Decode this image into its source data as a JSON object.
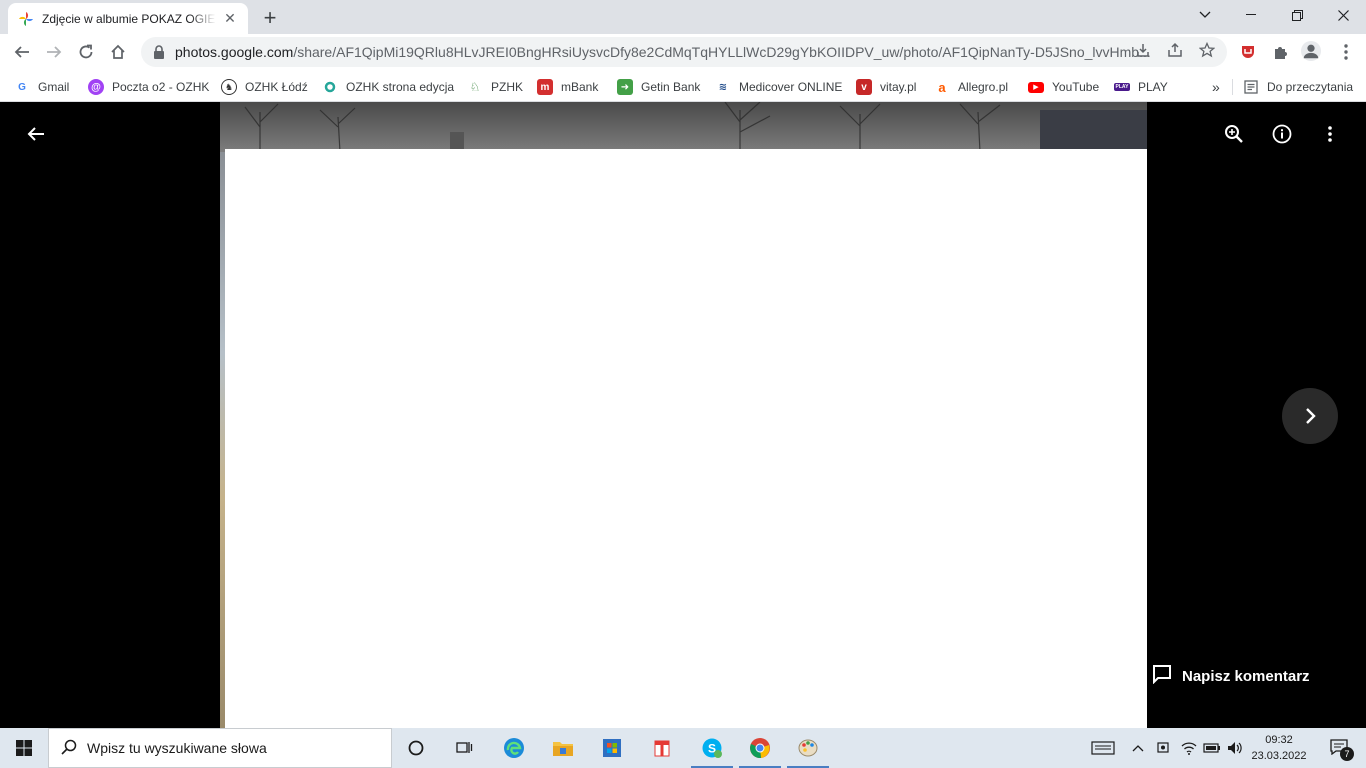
{
  "browser": {
    "tab_title": "Zdjęcie w albumie POKAZ OGIERÓW",
    "url_host": "photos.google.com",
    "url_path": "/share/AF1QipMi19QRlu8HLvJREI0BngHRsiUysvcDfy8e2CdMqTqHYLLlWcD29gYbKOIIDPV_uw/photo/AF1QipNanTy-D5JSno_lvvHmb..."
  },
  "bookmarks": [
    {
      "label": "Gmail",
      "icon": "google-icon",
      "color": "#4285f4"
    },
    {
      "label": "Poczta o2 - OZHK",
      "icon": "o2-mail-icon",
      "color": "#a142f4"
    },
    {
      "label": "OZHK Łódź",
      "icon": "horse-icon",
      "color": "#333333"
    },
    {
      "label": "OZHK strona edycja",
      "icon": "ring-icon",
      "color": "#26a69a"
    },
    {
      "label": "PZHK",
      "icon": "pzhk-icon",
      "color": "#2e7d32"
    },
    {
      "label": "mBank",
      "icon": "mbank-icon",
      "color": "#d32f2f"
    },
    {
      "label": "Getin Bank",
      "icon": "arrow-icon",
      "color": "#43a047"
    },
    {
      "label": "Medicover ONLINE",
      "icon": "medicover-icon",
      "color": "#1e4a8a"
    },
    {
      "label": "vitay.pl",
      "icon": "vitay-icon",
      "color": "#c62828"
    },
    {
      "label": "Allegro.pl",
      "icon": "allegro-icon",
      "color": "#ff5a00"
    },
    {
      "label": "YouTube",
      "icon": "youtube-icon",
      "color": "#ff0000"
    },
    {
      "label": "PLAY",
      "icon": "play-icon",
      "color": "#4a1a8c"
    }
  ],
  "bookmarks_more": "»",
  "reading_list": "Do przeczytania",
  "viewer": {
    "comment_label": "Napisz komentarz"
  },
  "taskbar": {
    "search_placeholder": "Wpisz tu wyszukiwane słowa",
    "time": "09:32",
    "date": "23.03.2022",
    "notifications_count": "7"
  }
}
